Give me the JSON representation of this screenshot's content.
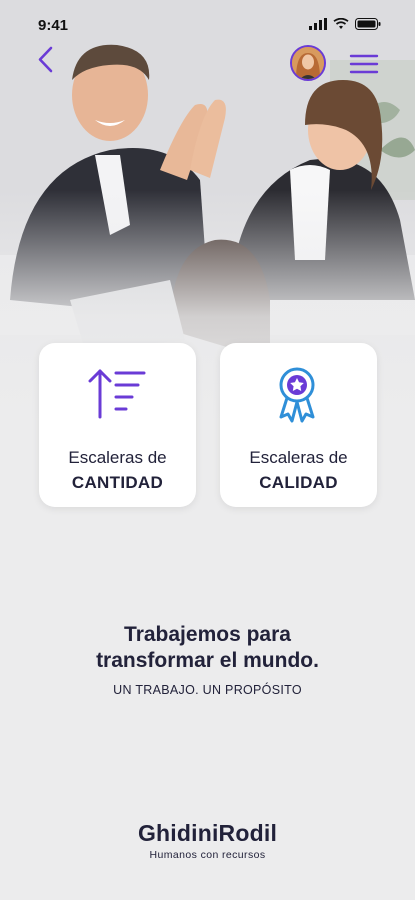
{
  "status_bar": {
    "time": "9:41"
  },
  "header": {
    "back_icon": "chevron-left-icon",
    "avatar": "user-avatar",
    "menu_icon": "menu-icon",
    "accent_color": "#6a3bd6"
  },
  "hero": {
    "image": "office-team-high-five-photo"
  },
  "cards": [
    {
      "icon": "sort-ascending-icon",
      "line1": "Escaleras de",
      "line2": "CANTIDAD"
    },
    {
      "icon": "award-ribbon-icon",
      "line1": "Escaleras de",
      "line2": "CALIDAD"
    }
  ],
  "tagline": {
    "line1": "Trabajemos para",
    "line2": "transformar el mundo.",
    "subtitle": "UN TRABAJO. UN PROPÓSITO"
  },
  "brand": {
    "name": "GhidiniRodil",
    "slogan": "Humanos con recursos"
  }
}
